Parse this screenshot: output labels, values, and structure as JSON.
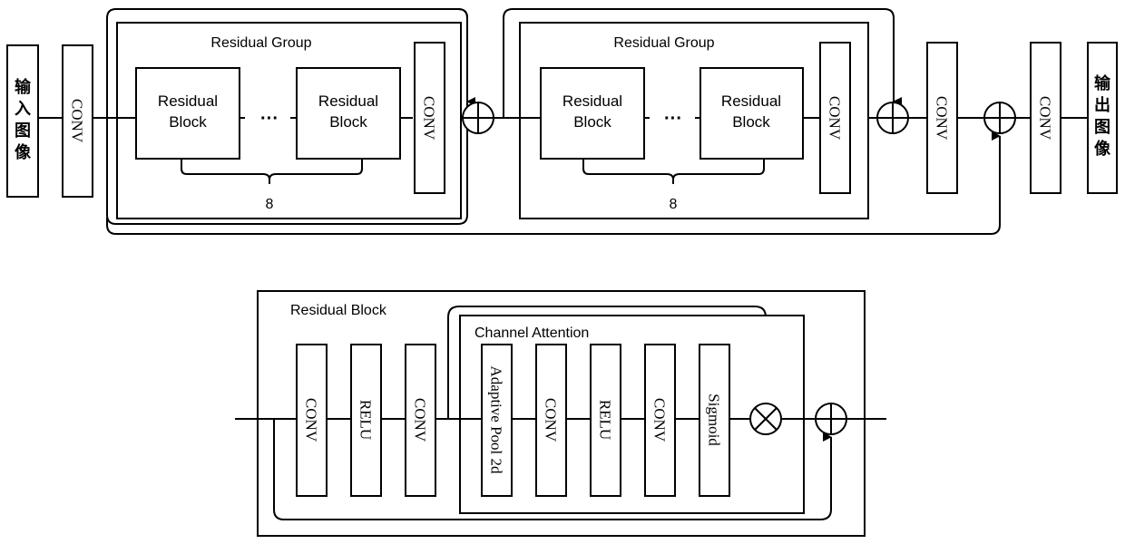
{
  "top": {
    "input_label": [
      "输",
      "入",
      "图",
      "像"
    ],
    "output_label": [
      "输",
      "出",
      "图",
      "像"
    ],
    "conv_label": "CONV",
    "groups": [
      {
        "title": "Residual Group",
        "block_label_line1": "Residual",
        "block_label_line2": "Block",
        "ellipsis": "···",
        "count": "8"
      },
      {
        "title": "Residual Group",
        "block_label_line1": "Residual",
        "block_label_line2": "Block",
        "ellipsis": "···",
        "count": "8"
      }
    ]
  },
  "bottom": {
    "title": "Residual Block",
    "attention_title": "Channel Attention",
    "layers": [
      "CONV",
      "RELU",
      "CONV"
    ],
    "attention_layers": [
      "Adaptive Pool 2d",
      "CONV",
      "RELU",
      "CONV",
      "Sigmoid"
    ]
  },
  "colors": {
    "stroke": "#000000",
    "background": "#ffffff"
  }
}
